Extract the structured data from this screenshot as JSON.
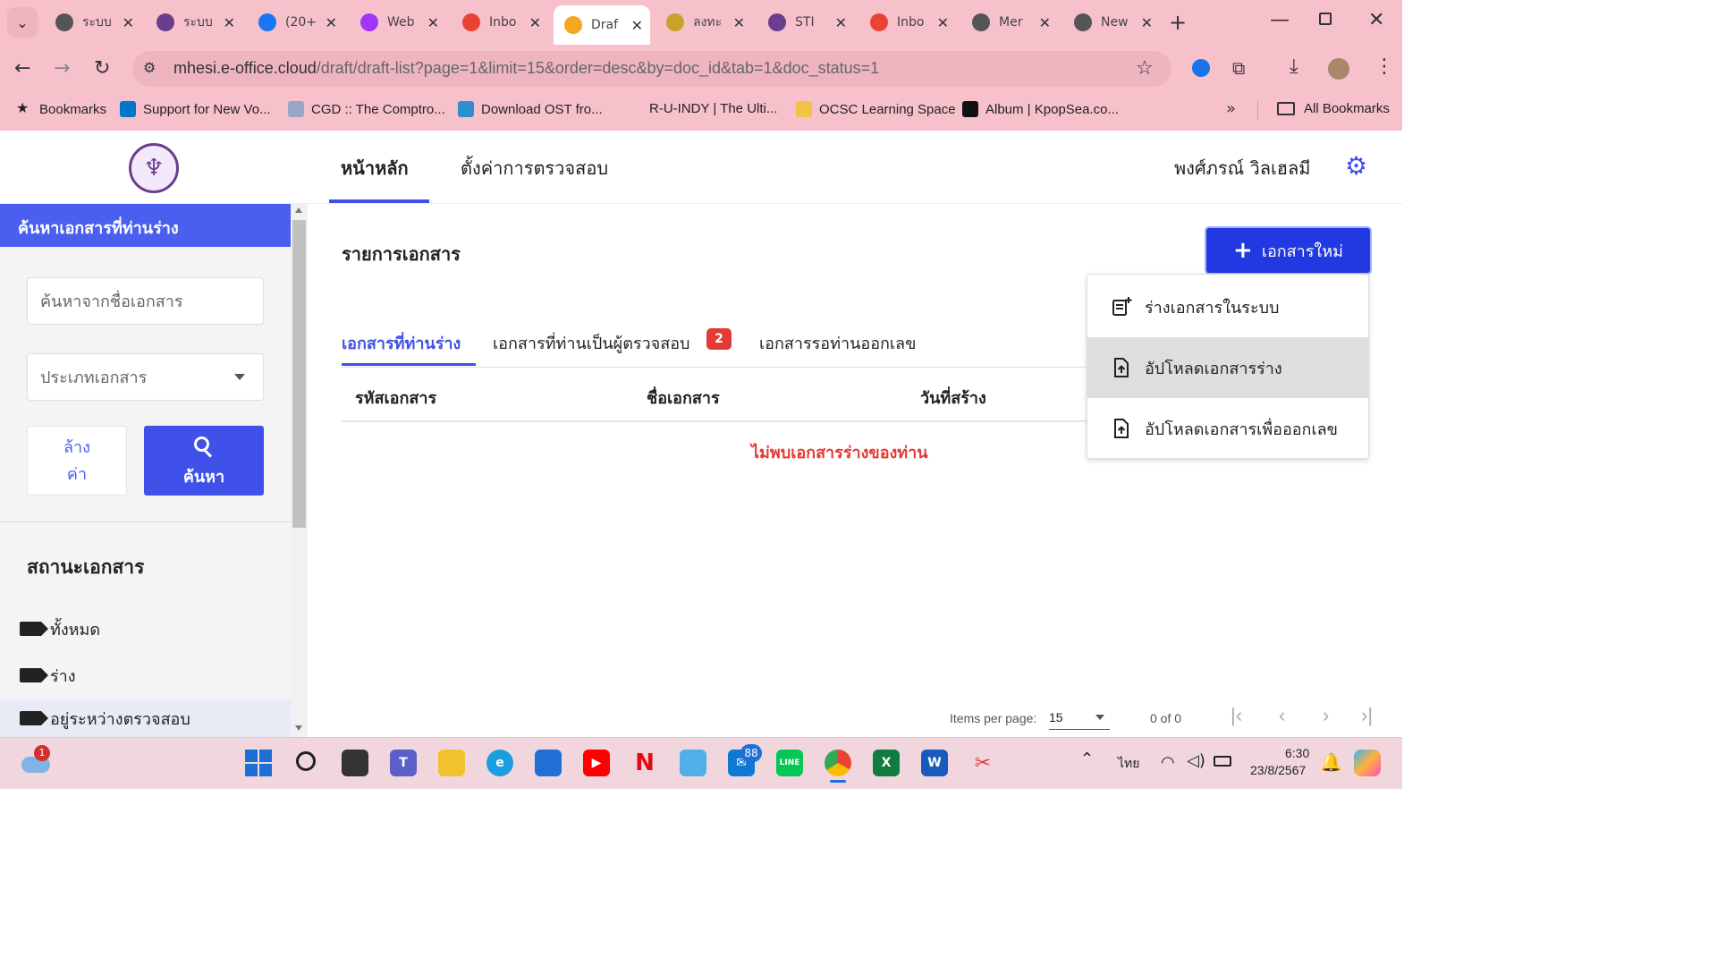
{
  "browser": {
    "tabs": [
      {
        "title": "ระบบ",
        "favicon": "globe-icon",
        "color": "#555555"
      },
      {
        "title": "ระบบ",
        "favicon": "mhesi-logo-icon",
        "color": "#6a3d8e"
      },
      {
        "title": "(20+",
        "favicon": "facebook-icon",
        "color": "#1877f2"
      },
      {
        "title": "Web",
        "favicon": "messenger-icon",
        "color": "#a334fa"
      },
      {
        "title": "Inbo",
        "favicon": "gmail-icon",
        "color": "#ea4335"
      },
      {
        "title": "Draf",
        "favicon": "eoffice-icon",
        "color": "#f5a623"
      },
      {
        "title": "ลงทะ",
        "favicon": "thai-logo-icon",
        "color": "#c9a227"
      },
      {
        "title": "STI",
        "favicon": "mhesi-logo-icon",
        "color": "#6a3d8e"
      },
      {
        "title": "Inbo",
        "favicon": "gmail-icon",
        "color": "#ea4335"
      },
      {
        "title": "Mer",
        "favicon": "globe-icon",
        "color": "#555555"
      },
      {
        "title": "New",
        "favicon": "globe-icon",
        "color": "#555555"
      }
    ],
    "active_tab_index": 5,
    "url_host": "mhesi.e-office.cloud",
    "url_path": "/draft/draft-list?page=1&limit=15&order=desc&by=doc_id&tab=1&doc_status=1",
    "bookmarks": [
      {
        "label": "Bookmarks",
        "icon": "star-icon"
      },
      {
        "label": "Support for New Vo...",
        "icon": "dell-icon"
      },
      {
        "label": "CGD :: The Comptro...",
        "icon": "cgd-icon"
      },
      {
        "label": "Download OST fro...",
        "icon": "shield-icon"
      },
      {
        "label": "R-U-INDY | The Ulti...",
        "icon": "none"
      },
      {
        "label": "OCSC Learning Space",
        "icon": "bulb-icon"
      },
      {
        "label": "Album | KpopSea.co...",
        "icon": "k-icon"
      }
    ],
    "all_bookmarks_label": "All Bookmarks"
  },
  "app": {
    "nav": {
      "home": "หน้าหลัก",
      "settings": "ตั้งค่าการตรวจสอบ"
    },
    "user_name": "พงศ์ภรณ์ วิลเฮลมี",
    "accent": "#3f51e8"
  },
  "sidebar": {
    "title": "ค้นหาเอกสารที่ท่านร่าง",
    "search_placeholder": "ค้นหาจากชื่อเอกสาร",
    "doc_type_placeholder": "ประเภทเอกสาร",
    "clear_label_1": "ล้าง",
    "clear_label_2": "ค่า",
    "search_label": "ค้นหา",
    "status_title": "สถานะเอกสาร",
    "status_items": [
      "ทั้งหมด",
      "ร่าง",
      "อยู่ระหว่างตรวจสอบ"
    ]
  },
  "main": {
    "title": "รายการเอกสาร",
    "new_doc_label": "เอกสารใหม่",
    "tabs": [
      {
        "label": "เอกสารที่ท่านร่าง"
      },
      {
        "label": "เอกสารที่ท่านเป็นผู้ตรวจสอบ",
        "badge": "2"
      },
      {
        "label": "เอกสารรอท่านออกเลข"
      }
    ],
    "columns": [
      "รหัสเอกสาร",
      "ชื่อเอกสาร",
      "วันที่สร้าง"
    ],
    "empty_message": "ไม่พบเอกสารร่างของท่าน",
    "menu": [
      {
        "label": "ร่างเอกสารในระบบ",
        "icon": "new-document-icon"
      },
      {
        "label": "อัปโหลดเอกสารร่าง",
        "icon": "upload-file-icon"
      },
      {
        "label": "อัปโหลดเอกสารเพื่อออกเลข",
        "icon": "upload-file-icon"
      }
    ],
    "paginator": {
      "items_per_page_label": "Items per page:",
      "page_size": "15",
      "range_label": "0 of 0"
    }
  },
  "taskbar": {
    "weather_badge": "1",
    "mail_badge": "88",
    "language": "ไทย",
    "time": "6:30",
    "date": "23/8/2567"
  }
}
